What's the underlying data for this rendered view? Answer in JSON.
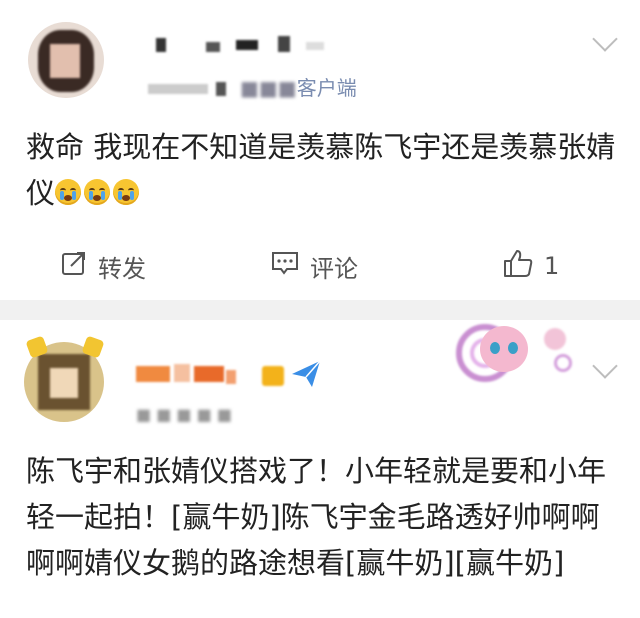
{
  "post1": {
    "source_suffix": "客户端",
    "text": "救命 我现在不知道是羡慕陈飞宇还是羡慕张婧仪",
    "emoji_name": "crying-face",
    "actions": {
      "repost_label": "转发",
      "comment_label": "评论",
      "like_count": "1"
    }
  },
  "post2": {
    "text": "陈飞宇和张婧仪搭戏了！小年轻就是要和小年轻一起拍！[赢牛奶]陈飞宇金毛路透好帅啊啊啊啊婧仪女鹅的路途想看[赢牛奶][赢牛奶]"
  },
  "colors": {
    "separator": "#f1f1f1",
    "source_link": "#7a8cb0",
    "icon_gray": "#555555"
  }
}
